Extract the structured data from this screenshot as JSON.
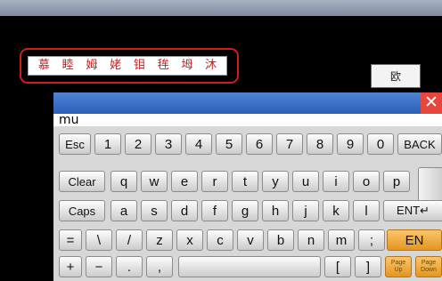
{
  "candidates": [
    "慕",
    "睦",
    "姆",
    "姥",
    "钼",
    "毪",
    "坶",
    "沐"
  ],
  "lang_button": "欧",
  "composition": "mu",
  "close_symbol": "✕",
  "keys": {
    "esc": "Esc",
    "1": "1",
    "2": "2",
    "3": "3",
    "4": "4",
    "5": "5",
    "6": "6",
    "7": "7",
    "8": "8",
    "9": "9",
    "0": "0",
    "back": "BACK",
    "clear": "Clear",
    "q": "q",
    "w": "w",
    "e": "e",
    "r": "r",
    "t": "t",
    "y": "y",
    "u": "u",
    "i": "i",
    "o": "o",
    "p": "p",
    "caps": "Caps",
    "a": "a",
    "s": "s",
    "d": "d",
    "f": "f",
    "g": "g",
    "h": "h",
    "j": "j",
    "k": "k",
    "l": "l",
    "ent": "ENT↵",
    "eq": "=",
    "backslash": "\\",
    "slash": "/",
    "z": "z",
    "x": "x",
    "c": "c",
    "v": "v",
    "b": "b",
    "n": "n",
    "m": "m",
    "semicolon": ";",
    "en": "EN",
    "plus": "+",
    "minus": "−",
    "dot": ".",
    "comma": ",",
    "space": "",
    "lbracket": "[",
    "rbracket": "]",
    "pageup_1": "Page",
    "pageup_2": "Up",
    "pagedown_1": "Page",
    "pagedown_2": "Down"
  },
  "colors": {
    "candidate_text": "#c21e1e",
    "ring": "#d21b1b",
    "titlebar": "#2c5fb8",
    "accent_key": "#e49620"
  }
}
